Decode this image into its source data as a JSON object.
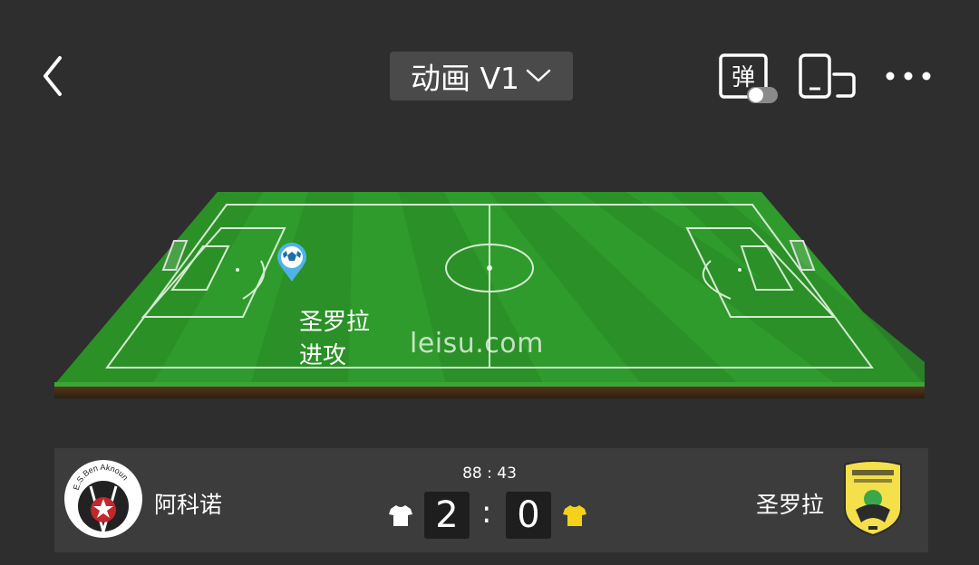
{
  "header": {
    "mode_label": "动画 V1",
    "danmu_label": "弹"
  },
  "pitch": {
    "watermark": "leisu.com",
    "event_team": "圣罗拉",
    "event_action": "进攻"
  },
  "match": {
    "time": "88 : 43",
    "home": {
      "name": "阿科诺",
      "logo_text": "E.S.Ben Aknoun",
      "score": "2",
      "jersey_color": "#ffffff"
    },
    "away": {
      "name": "圣罗拉",
      "score": "0",
      "jersey_color": "#f5d21a"
    },
    "separator": ":"
  },
  "colors": {
    "background": "#2e2e2e",
    "panel": "#3c3c3c",
    "pitch_green": "#2e9a2b",
    "ball_marker": "#4fb3e8"
  }
}
